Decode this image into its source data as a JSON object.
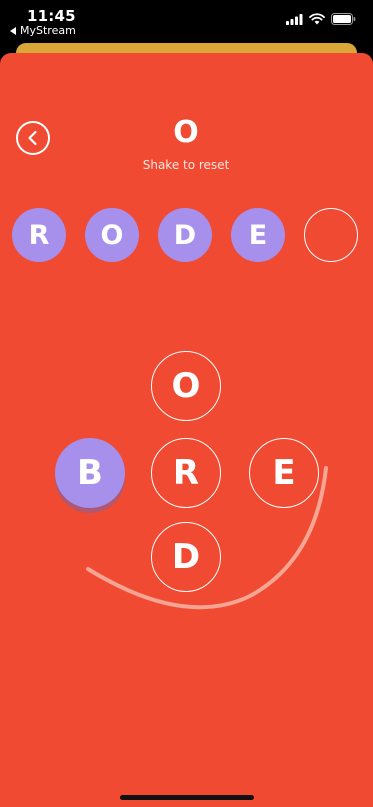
{
  "status_bar": {
    "time": "11:45",
    "back_app": "MyStream",
    "icons": [
      "signal-icon",
      "wifi-icon",
      "battery-icon"
    ]
  },
  "header": {
    "current_letter": "O",
    "hint": "Shake to reset"
  },
  "word_slots": [
    {
      "letter": "R",
      "filled": true
    },
    {
      "letter": "O",
      "filled": true
    },
    {
      "letter": "D",
      "filled": true
    },
    {
      "letter": "E",
      "filled": true
    },
    {
      "letter": "",
      "filled": false
    }
  ],
  "tiles": {
    "top": "O",
    "left": "B",
    "center": "R",
    "right": "E",
    "bottom": "D"
  },
  "colors": {
    "background": "#f04a32",
    "accent": "#a690ec",
    "sheet_behind": "#d9a637"
  }
}
